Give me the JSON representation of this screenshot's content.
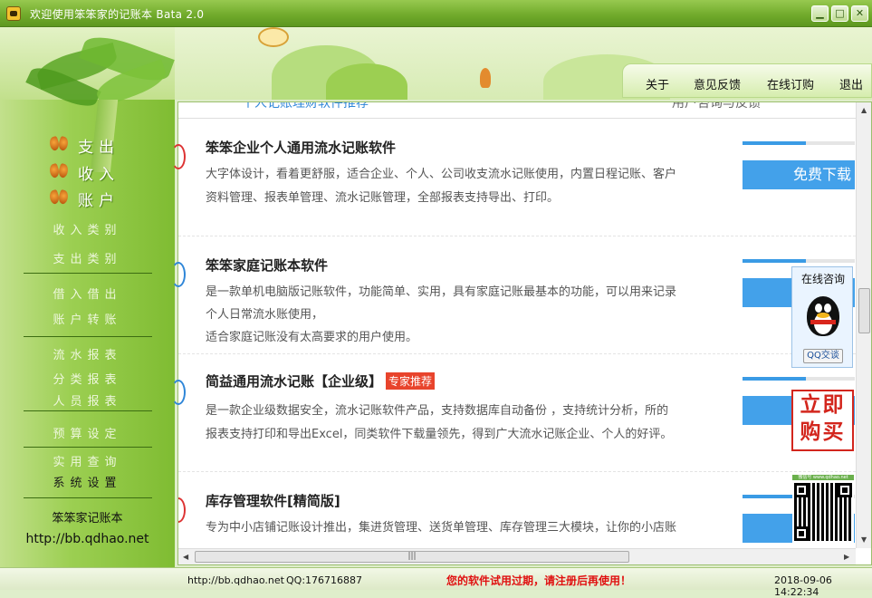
{
  "window": {
    "title": "欢迎使用笨笨家的记账本 Bata 2.0",
    "minimize": "▁",
    "maximize": "□",
    "close": "✕"
  },
  "top_nav": [
    "关于",
    "意见反馈",
    "在线订购",
    "退出"
  ],
  "sidebar": {
    "main_items": [
      "支出",
      "收入",
      "账户"
    ],
    "sub_items": [
      "收入类别",
      "支出类别",
      "借入借出",
      "账户转账",
      "流水报表",
      "分类报表",
      "人员报表",
      "预算设定",
      "实用查询",
      "系统设置"
    ],
    "brand_name": "笨笨家记账本",
    "brand_url": "http://bb.qdhao.net"
  },
  "content": {
    "tab_a": "个人记账理财软件推荐",
    "tab_b": "用户咨询与反馈",
    "download_label": "免费下载",
    "products": [
      {
        "title": "笨笨企业个人通用流水记账软件",
        "desc1": "大字体设计，看着更舒服，适合企业、个人、公司收支流水记账使用，内置日程记账、客户",
        "desc2": "资料管理、报表单管理、流水记账管理，全部报表支持导出、打印。"
      },
      {
        "title": "笨笨家庭记账本软件",
        "desc1": "是一款单机电脑版记账软件，功能简单、实用，具有家庭记账最基本的功能，可以用来记录",
        "desc2": "个人日常流水账使用，",
        "desc3": "适合家庭记账没有太高要求的用户使用。"
      },
      {
        "title": "简益通用流水记账【企业级】",
        "badge": "专家推荐",
        "desc1": "是一款企业级数据安全，流水记账软件产品，支持数据库自动备份 ，支持统计分析，所的",
        "desc2": "报表支持打印和导出Excel，同类软件下载量领先，得到广大流水记账企业、个人的好评。"
      },
      {
        "title": "库存管理软件[精简版]",
        "desc1": "专为中小店铺记账设计推出，集进货管理、送货单管理、库存管理三大模块，让你的小店账"
      }
    ]
  },
  "widgets": {
    "qq_label": "在线咨询",
    "qq_button": "QQ交谈",
    "buy_line1": "立即",
    "buy_line2": "购买",
    "qr_caption": "微信号 www.qdhao.net"
  },
  "statusbar": {
    "url": "http://bb.qdhao.net",
    "qq": "QQ:176716887",
    "warning": "您的软件试用过期，请注册后再使用！",
    "datetime": "2018-09-06 14:22:34"
  },
  "colors": {
    "title_bar": "#6fa92a",
    "sidebar": "#9ccf52",
    "download_button": "#43a1ea",
    "warning": "#e01010",
    "buy_red": "#d3261d"
  }
}
